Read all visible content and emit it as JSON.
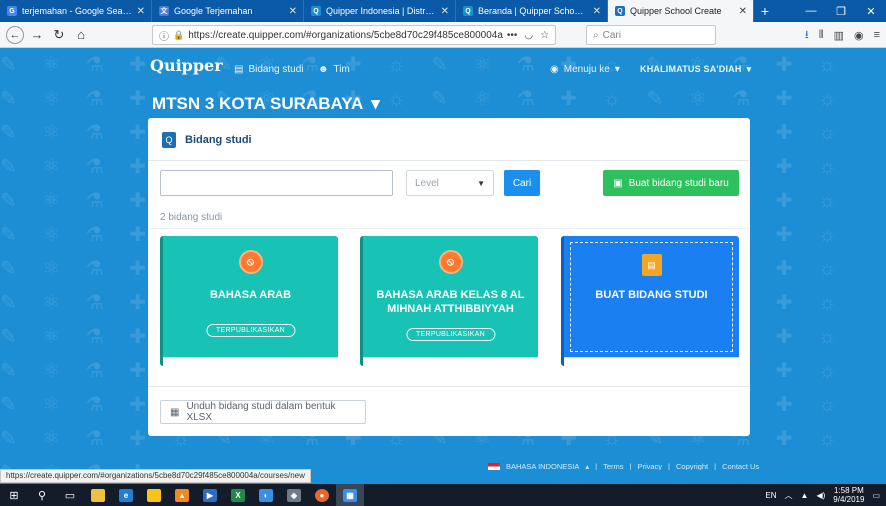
{
  "browser": {
    "tabs": [
      {
        "title": "terjemahan - Google Search",
        "icon": "google-icon",
        "color": "#4285f4",
        "active": false
      },
      {
        "title": "Google Terjemahan",
        "icon": "google-translate-icon",
        "color": "#4a7bd8",
        "active": false
      },
      {
        "title": "Quipper Indonesia | Distributo",
        "icon": "quipper-icon",
        "color": "#1a8fd6",
        "active": false
      },
      {
        "title": "Beranda | Quipper School LINK",
        "icon": "quipper-icon",
        "color": "#1a8fd6",
        "active": false
      },
      {
        "title": "Quipper School Create",
        "icon": "quipper-icon",
        "color": "#1a6fc0",
        "active": true
      }
    ],
    "url": "https://create.quipper.com/#organizations/5cbe8d70c29f485ce800004a",
    "search_placeholder": "Cari",
    "status_url": "https://create.quipper.com/#organizations/5cbe8d70c29f485ce800004a/courses/new"
  },
  "app": {
    "logo": "Quipper",
    "nav": [
      {
        "label": "Bidang studi",
        "icon": "book-icon"
      },
      {
        "label": "Tim",
        "icon": "team-icon"
      }
    ],
    "menuju_label": "Menuju ke",
    "user_name": "KHALIMATUS SA'DIAH",
    "org_title": "MTSN 3 KOTA SURABAYA"
  },
  "card": {
    "heading": "Bidang studi",
    "search_value": "",
    "level_placeholder": "Level",
    "search_button": "Cari",
    "new_button": "Buat bidang studi baru",
    "count_text": "2 bidang studi",
    "courses": [
      {
        "name": "BAHASA ARAB",
        "status": "TERPUBLIKASIKAN"
      },
      {
        "name": "BAHASA ARAB KELAS 8 AL MIHNAH ATTHIBBIYYAH",
        "status": "TERPUBLIKASIKAN"
      }
    ],
    "create_tile_label": "BUAT BIDANG STUDI",
    "download_button": "Unduh bidang studi dalam bentuk XLSX"
  },
  "footer": {
    "language": "BAHASA INDONESIA",
    "links": [
      "Terms",
      "Privacy",
      "Copyright",
      "Contact Us"
    ]
  },
  "taskbar": {
    "lang": "EN",
    "time": "1:58 PM",
    "date": "9/4/2019"
  }
}
